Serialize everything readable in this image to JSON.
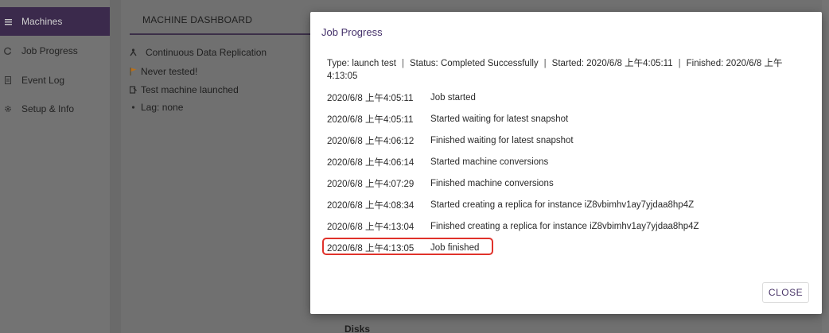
{
  "sidebar": {
    "items": [
      {
        "label": "Machines",
        "icon": "list-icon",
        "active": true
      },
      {
        "label": "Job Progress",
        "icon": "refresh-icon",
        "active": false
      },
      {
        "label": "Event Log",
        "icon": "document-icon",
        "active": false
      },
      {
        "label": "Setup & Info",
        "icon": "gear-icon",
        "active": false
      }
    ]
  },
  "dashboard": {
    "title": "MACHINE DASHBOARD",
    "lines": [
      {
        "text": "Continuous Data Replication",
        "icon": "replication-icon"
      },
      {
        "text": "Never tested!",
        "icon": "flag-icon"
      },
      {
        "text": "Test machine launched",
        "icon": "test-icon"
      },
      {
        "text": "Lag: none",
        "icon": "bullet-icon"
      }
    ],
    "disks_label": "Disks"
  },
  "modal": {
    "title": "Job Progress",
    "summary": {
      "type": "Type: launch test",
      "status": "Status: Completed Successfully",
      "started": "Started: 2020/6/8 上午4:05:11",
      "finished_label": "Finished: 2020/6/8 上午",
      "finished_time": "4:13:05",
      "separator": "|"
    },
    "events": [
      {
        "time": "2020/6/8 上午4:05:11",
        "message": "Job started"
      },
      {
        "time": "2020/6/8 上午4:05:11",
        "message": "Started waiting for latest snapshot"
      },
      {
        "time": "2020/6/8 上午4:06:12",
        "message": "Finished waiting for latest snapshot"
      },
      {
        "time": "2020/6/8 上午4:06:14",
        "message": "Started machine conversions"
      },
      {
        "time": "2020/6/8 上午4:07:29",
        "message": "Finished machine conversions"
      },
      {
        "time": "2020/6/8 上午4:08:34",
        "message": "Started creating a replica for instance iZ8vbimhv1ay7yjdaa8hp4Z"
      },
      {
        "time": "2020/6/8 上午4:13:04",
        "message": "Finished creating a replica for instance iZ8vbimhv1ay7yjdaa8hp4Z"
      },
      {
        "time": "2020/6/8 上午4:13:05",
        "message": "Job finished"
      }
    ],
    "close_label": "CLOSE"
  },
  "colors": {
    "accent": "#44306a",
    "sidebar_active": "#3b2a4c",
    "highlight": "#e0322b",
    "overlay": "#707070"
  }
}
